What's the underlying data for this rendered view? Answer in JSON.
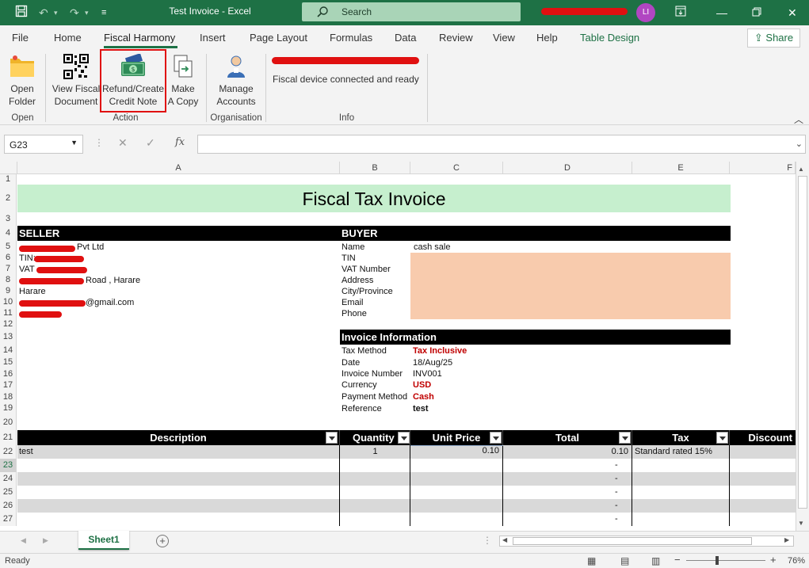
{
  "titlebar": {
    "title": "Test Invoice  -  Excel",
    "search_placeholder": "Search",
    "avatar_initials": "LI"
  },
  "menu": [
    "File",
    "Home",
    "Fiscal Harmony",
    "Insert",
    "Page Layout",
    "Formulas",
    "Data",
    "Review",
    "View",
    "Help",
    "Table Design"
  ],
  "share_label": "Share",
  "ribbon": {
    "open_folder": "Open\nFolder",
    "view_fiscal": "View Fiscal\nDocument",
    "refund": "Refund/Create\nCredit Note",
    "make_copy": "Make\nA Copy",
    "manage": "Manage\nAccounts",
    "info_status": "Fiscal device connected and ready",
    "groups": {
      "open": "Open",
      "action": "Action",
      "organisation": "Organisation",
      "info": "Info"
    }
  },
  "namebox": "G23",
  "columns": [
    "A",
    "B",
    "C",
    "D",
    "E",
    "F"
  ],
  "rows": [
    "1",
    "2",
    "3",
    "4",
    "5",
    "6",
    "7",
    "8",
    "9",
    "10",
    "11",
    "12",
    "13",
    "14",
    "15",
    "16",
    "17",
    "18",
    "19",
    "20",
    "21",
    "22",
    "23",
    "24",
    "25",
    "26",
    "27"
  ],
  "invoice": {
    "title": "Fiscal Tax Invoice",
    "seller_hdr": "SELLER",
    "buyer_hdr": "BUYER",
    "seller": {
      "company_suffix": "Pvt Ltd",
      "tin": "TIN:",
      "vat": "VAT",
      "address_suffix": "Road , Harare",
      "city": "Harare",
      "email_suffix": "@gmail.com"
    },
    "buyer_labels": [
      "Name",
      "TIN",
      "VAT Number",
      "Address",
      "City/Province",
      "Email",
      "Phone"
    ],
    "buyer_name": "cash sale",
    "info_hdr": "Invoice Information",
    "info": [
      {
        "label": "Tax Method",
        "value": "Tax Inclusive",
        "red": true
      },
      {
        "label": "Date",
        "value": "18/Aug/25",
        "red": false
      },
      {
        "label": "Invoice Number",
        "value": "INV001",
        "red": false
      },
      {
        "label": "Currency",
        "value": "USD",
        "red": true
      },
      {
        "label": "Payment Method",
        "value": "Cash",
        "red": true
      },
      {
        "label": "Reference",
        "value": "test",
        "red": false,
        "bold": true
      }
    ],
    "table_headers": [
      "Description",
      "Quantity",
      "Unit Price",
      "Total",
      "Tax",
      "Discount"
    ],
    "line": {
      "desc": "test",
      "qty": "1",
      "price": "0.10",
      "total": "0.10",
      "tax": "Standard rated 15%"
    },
    "dash": "-"
  },
  "sheet_tab": "Sheet1",
  "status": {
    "ready": "Ready",
    "zoom": "76%"
  },
  "colors": {
    "excel_green": "#1e7145",
    "title_band": "#c6efce",
    "buyer_fill": "#f8cbad",
    "red_value": "#c00000"
  }
}
